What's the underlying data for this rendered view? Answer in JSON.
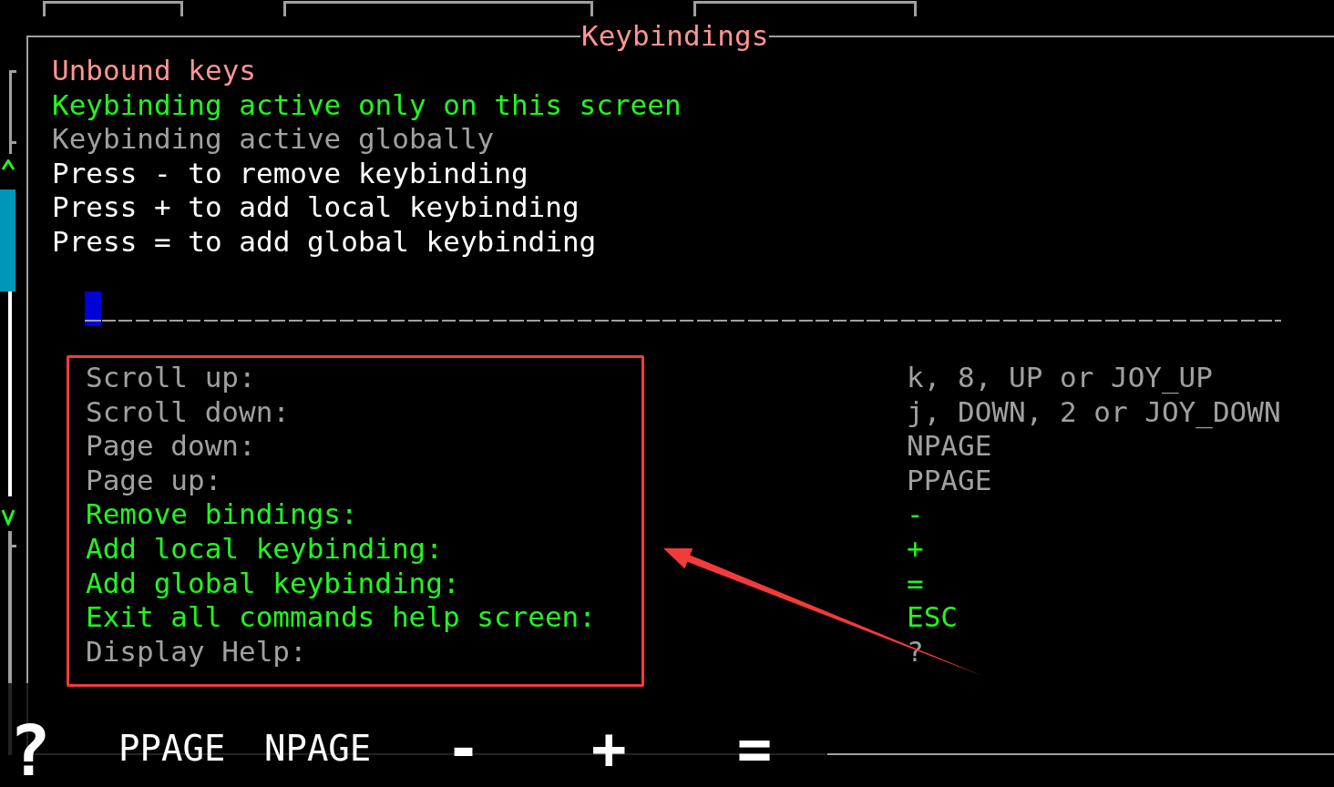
{
  "window": {
    "title": "Keybindings"
  },
  "legend": [
    {
      "text": "Unbound keys",
      "kind": "unbound"
    },
    {
      "text": "Keybinding active only on this screen",
      "kind": "local"
    },
    {
      "text": "Keybinding active globally",
      "kind": "global"
    },
    {
      "text": "Press - to remove keybinding",
      "kind": "instruction"
    },
    {
      "text": "Press + to add local keybinding",
      "kind": "instruction"
    },
    {
      "text": "Press = to add global keybinding",
      "kind": "instruction"
    }
  ],
  "filter": {
    "focused": true
  },
  "bindings": [
    {
      "action": "Scroll up:",
      "keys": "k, 8, UP or JOY_UP",
      "kind": "global"
    },
    {
      "action": "Scroll down:",
      "keys": "j, DOWN, 2 or JOY_DOWN",
      "kind": "global"
    },
    {
      "action": "Page down:",
      "keys": "NPAGE",
      "kind": "global"
    },
    {
      "action": "Page up:",
      "keys": "PPAGE",
      "kind": "global"
    },
    {
      "action": "Remove bindings:",
      "keys": "-",
      "kind": "local"
    },
    {
      "action": "Add local keybinding:",
      "keys": "+",
      "kind": "local"
    },
    {
      "action": "Add global keybinding:",
      "keys": "=",
      "kind": "local"
    },
    {
      "action": "Exit all commands help screen:",
      "keys": "ESC",
      "kind": "local"
    },
    {
      "action": "Display Help:",
      "keys": "?",
      "kind": "global"
    }
  ],
  "shortcuts": [
    {
      "label": "?",
      "kind": "help"
    },
    {
      "label": "PPAGE",
      "kind": "word"
    },
    {
      "label": "NPAGE",
      "kind": "word"
    },
    {
      "label": "-",
      "kind": "symbol"
    },
    {
      "label": "+",
      "kind": "symbol"
    },
    {
      "label": "=",
      "kind": "symbol"
    }
  ]
}
